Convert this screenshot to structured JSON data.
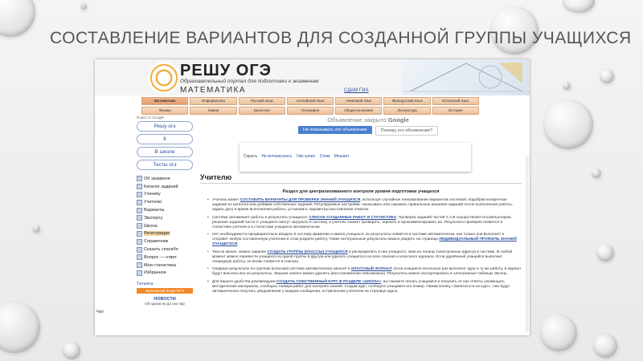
{
  "slide": {
    "title": "СОСТАВЛЕНИЕ ВАРИАНТОВ ДЛЯ СОЗДАННОЙ ГРУППЫ УЧАЩИХСЯ"
  },
  "site": {
    "logo": "РЕШУ ОГЭ",
    "tagline": "Образовательный портал для подготовки к экзаменам",
    "subject": "МАТЕМАТИКА",
    "sdam_link": "СДАМ ГИА"
  },
  "nav": {
    "row1": [
      "Математика",
      "Информатика",
      "Русский язык",
      "Английский язык",
      "Немецкий язык",
      "Французский язык",
      "Испанский язык"
    ],
    "row2": [
      "Физика",
      "Химия",
      "Биология",
      "География",
      "Обществознание",
      "Литература",
      "История"
    ]
  },
  "sidebar": {
    "google_label": "Поиск от Google",
    "buttons": [
      "Решу огэ",
      "6",
      "В школе",
      "Тесты огэ"
    ],
    "menu": [
      "Об экзамене",
      "Каталог заданий",
      "Ученику",
      "Учителю",
      "Варианты",
      "Эксперту",
      "Школа",
      "Регистрация",
      "Справочник",
      "Сказать спасибо",
      "Вопрос — ответ",
      "Мои статистика",
      "Избранное"
    ],
    "user_name": "Татьяна",
    "user_plate": "Банковский Форм ОГЭ",
    "news_title": "НОВОСТИ",
    "news_line": "Об одном из до сих пор",
    "chat_label": "Чат"
  },
  "ad": {
    "closed_prefix": "Объявление закрыто",
    "closed_brand": "Google",
    "btn_hide": "Не показывать это объявление",
    "btn_why": "Почему это объявление?",
    "panel_links": [
      "Скрыть",
      "Не интересуюсь",
      "Уже купил",
      "Спам",
      "Мешает"
    ]
  },
  "content": {
    "page_heading": "Учителю",
    "section_title": "Раздел для централизованного контроля уровня подготовки учащихся",
    "paragraphs": [
      {
        "text": "Учитель может ",
        "link": "СОСТАВИТЬ ВАРИАНТЫ ДЛЯ ПРОВЕРКИ ЗНАНИЙ УЧАЩИХСЯ",
        "rest": ", используя случайное генерирование вариантов системой, подобрав конкретные задания из каталога или добавив собственные задания. Регулируемые настройки: показывать или скрывать правильные решения заданий после выполнения работы, задать дату и время выполнения работы, установить параметры выставления отметок."
      },
      {
        "text": "Система запоминает работы и результаты учащихся: ",
        "link": "СПИСОК СОЗДАННЫХ РАБОТ И СТАТИСТИКА",
        "rest": ". Проверка заданий частей А и В осуществляется компьютером, решения заданий части С учащиеся смогут загрузить в систему, а учитель сможет проверить, оценить и прокомментировать их. Результаты проверки появятся в статистике учителя и в статистике учащихся автоматически."
      },
      {
        "text": "Нет необходимости предварительно вводить в систему фамилии и имена учащихся: их результаты появятся в системе автоматически, как только они выполнят и отправят любую составленную учителем в этом разделе работу. Также интегральные результаты можно увидеть на странице ",
        "link": "ИНДИВИДУАЛЬНЫЙ ПРОФИЛЬ ЗНАНИЙ УЧАЩЕГОСЯ",
        "rest": "."
      },
      {
        "text": "Тем не менее, можно заранее ",
        "link": "СОЗДАТЬ ГРУППЫ (КЛАССЫ) УЧАЩИХСЯ",
        "rest": " и распределить в них учащихся, зная их логины (электронные адреса) в системе. В любой момент можно перевести учащихся из одной группы в другую или удалить учащегося из всех списков и классного журнала. Если удалённый учащийся выполнит очередную работу, он вновь появится в списках."
      },
      {
        "text": "Сводные результаты по группам (классам) система автоматически заносит в ",
        "link": "КЛАССНЫЙ ЖУРНАЛ",
        "rest": ". Если учащиеся несколько раз выполнят одну и ту же работу, в журнал будут внесены все их результаты. Лишние записи можно удалить (восстановление невозможно). Результаты можно экспортировать в электронные таблицы Эксель."
      },
      {
        "text": "Для вашего удобства рекомендуем ",
        "link": "СОЗДАТЬ СОБСТВЕННЫЙ КУРС В РАЗДЕЛЕ «ШКОЛА»",
        "rest": ": вы сможете писать учащимся и получать от них ответы, размещать методические материалы, сообщать номера работ для контроля знаний. Создав курс, сообщите учащимся его номер. Нажав кнопку «Записаться на курс», они будут автоматически получать уведомления о каждом сообщении, оставленном учителем на странице курса."
      }
    ]
  }
}
